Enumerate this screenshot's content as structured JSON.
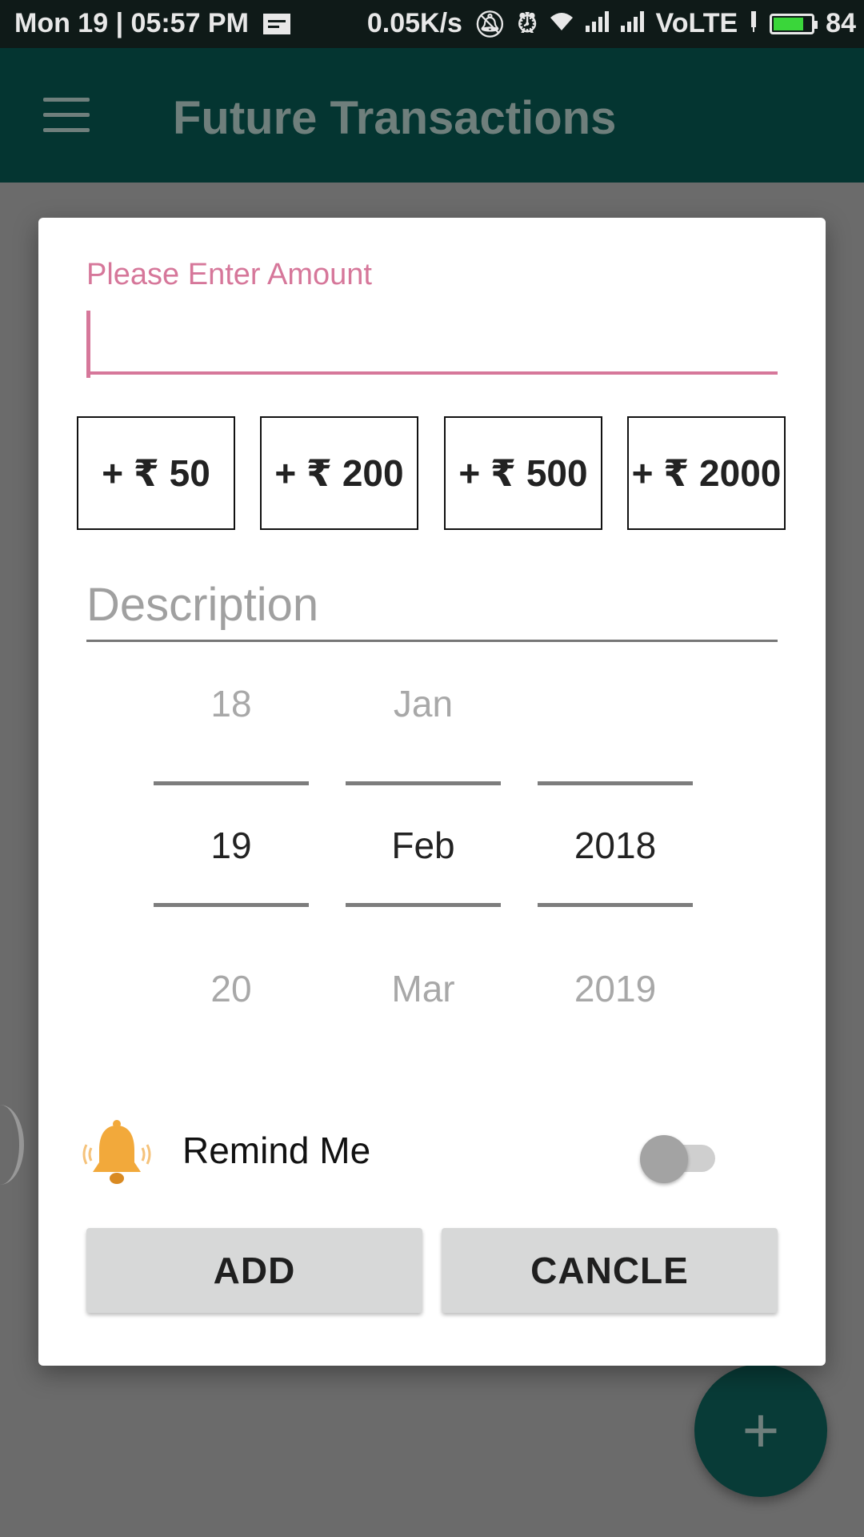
{
  "status_bar": {
    "left_text": "Mon 19 | 05:57 PM",
    "speed": "0.05K/s",
    "network": "VoLTE",
    "battery": "84",
    "battery_level": 0.84,
    "icons": [
      "notification-icon",
      "mute-icon",
      "alarm-icon",
      "wifi-icon",
      "signal-icon",
      "signal-icon",
      "charging-icon",
      "battery-icon"
    ]
  },
  "app_bar": {
    "title": "Future Transactions",
    "menu_icon": "hamburger-menu-icon"
  },
  "dialog": {
    "amount_label": "Please Enter Amount",
    "amount_value": "",
    "quick_amounts": [
      "+ ₹ 50",
      "+ ₹ 200",
      "+ ₹ 500",
      "+ ₹ 2000"
    ],
    "description_placeholder": "Description",
    "date_picker": {
      "day": {
        "prev": "18",
        "selected": "19",
        "next": "20"
      },
      "month": {
        "prev": "Jan",
        "selected": "Feb",
        "next": "Mar"
      },
      "year": {
        "prev": "",
        "selected": "2018",
        "next": "2019"
      }
    },
    "remind_label": "Remind Me",
    "remind_on": false,
    "add_label": "ADD",
    "cancel_label": "CANCLE"
  },
  "fab": {
    "label": "+"
  },
  "colors": {
    "accent": "#d6779a",
    "app_bar": "#043531",
    "fab": "#083b37",
    "bell": "#f2a93b"
  }
}
